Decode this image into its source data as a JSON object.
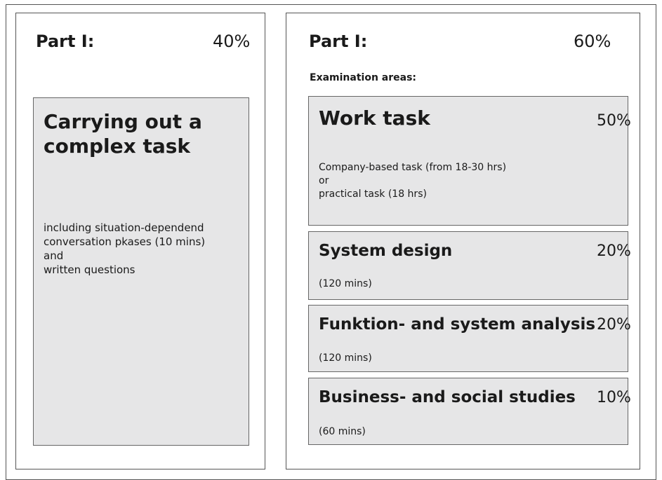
{
  "left_part": {
    "title": "Part I:",
    "percent": "40%",
    "box": {
      "title": "Carrying out a complex task",
      "description": "including situation-dependend\nconversation pkases (10 mins)\nand\nwritten questions"
    }
  },
  "right_part": {
    "title": "Part I:",
    "percent": "60%",
    "areas_label": "Examination areas:",
    "areas": [
      {
        "title": "Work task",
        "percent": "50%",
        "description": "Company-based task (from 18-30 hrs)\nor\npractical task (18 hrs)"
      },
      {
        "title": "System design",
        "percent": "20%",
        "description": "(120 mins)"
      },
      {
        "title": "Funktion- and system analysis",
        "percent": "20%",
        "description": "(120 mins)"
      },
      {
        "title": "Business- and social studies",
        "percent": "10%",
        "description": "(60 mins)"
      }
    ]
  }
}
